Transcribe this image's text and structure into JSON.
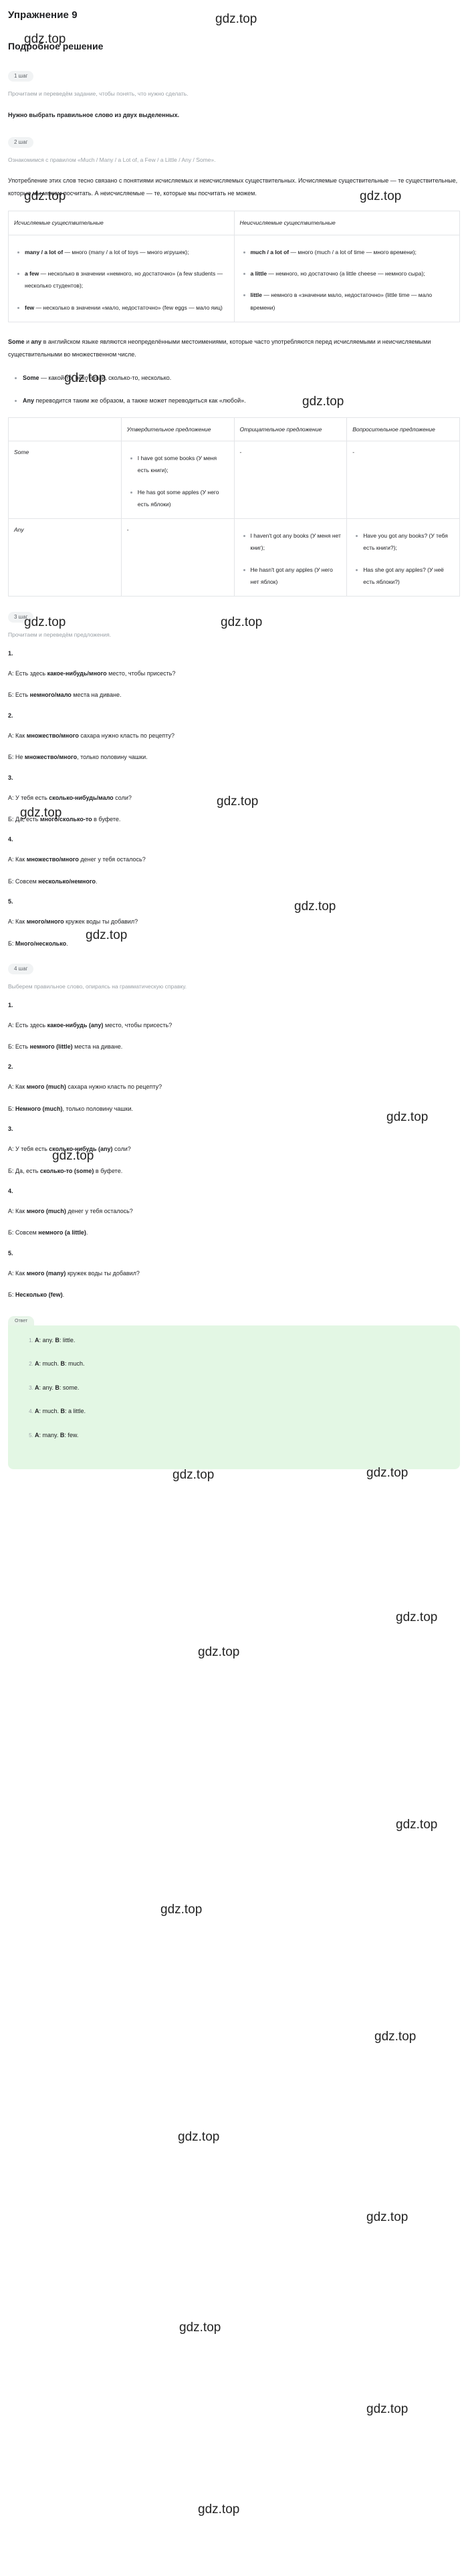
{
  "watermark": {
    "text": "gdz.top"
  },
  "header": {
    "title": "Упражнение 9",
    "subtitle": "Подробное решение"
  },
  "steps": [
    {
      "badge": "1 шаг",
      "hint": "Прочитаем и переведём задание, чтобы понять, что нужно сделать.",
      "statement": "Нужно выбрать правильное слово из двух выделенных."
    },
    {
      "badge": "2 шаг",
      "hint": "Ознакомимся с правилом «Much / Many / a Lot of, a Few / a Little / Any / Some».",
      "paragraph": "Употребление этих слов тесно связано с понятиями исчисляемых и неисчисляемых существительных. Исчисляемые существительные — те существительные, которые мы можем посчитать. А неисчисляемые — те, которые мы посчитать не можем."
    },
    {
      "badge": "3 шаг",
      "hint": "Прочитаем и переведём предложения."
    },
    {
      "badge": "4 шаг",
      "hint": "Выберем правильное слово, опираясь на грамматическую справку."
    }
  ],
  "nouns_table": {
    "headers": [
      "Исчисляемые существительные",
      "Неисчисляемые существительные"
    ],
    "countable": [
      {
        "term": "many / a lot of",
        "rest": " — много (many / a lot of toys — много игрушек);"
      },
      {
        "term": "a few",
        "rest": " — несколько в значении «немного, но достаточно» (a few students — несколько студентов);"
      },
      {
        "term": "few",
        "rest": " — несколько в значении «мало, недостаточно» (few eggs — мало яиц)"
      }
    ],
    "uncountable": [
      {
        "term": "much / a lot of",
        "rest": " — много (much / a lot of time — много времени);"
      },
      {
        "term": "a little",
        "rest": " — немного, но достаточно (a little cheese — немного сыра);"
      },
      {
        "term": "little",
        "rest": " — немного в «значении мало, недостаточно» (little time — мало времени)"
      }
    ]
  },
  "some_any_intro": {
    "lead_bold_1": "Some",
    "lead_mid": " и ",
    "lead_bold_2": "any",
    "lead_rest": " в английском языке являются неопределёнными местоимениями, которые часто употребляются перед исчисляемыми и неисчисляемыми существительными во множественном числе.",
    "bullets": [
      {
        "term": "Some",
        "rest": " — какой-то, некоторый, сколько-то, несколько."
      },
      {
        "term": "Any",
        "rest": " переводится таким же образом, а также может переводиться как «любой»."
      }
    ]
  },
  "some_any_table": {
    "headers": [
      "",
      "Утвердительное предложение",
      "Отрицательное предложение",
      "Вопросительное предложение"
    ],
    "rows": [
      {
        "label": "Some",
        "affirmative": [
          "I have got some books (У меня есть книги);",
          "He has got some apples (У него есть яблоки)"
        ],
        "negative_dash": "-",
        "interrogative_dash": "-"
      },
      {
        "label": "Any",
        "affirmative_dash": "-",
        "negative": [
          "I haven't got any books (У меня нет книг);",
          "He hasn't got any apples (У него нет яблок)"
        ],
        "interrogative": [
          "Have you got any books? (У тебя есть книги?);",
          "Has she got any apples? (У неё есть яблоки?)"
        ]
      }
    ]
  },
  "step3_items": [
    {
      "num": "1.",
      "a_prefix": "А: Есть здесь ",
      "a_bold": "какое-нибудь/много",
      "a_suffix": " место, чтобы присесть?",
      "b_prefix": "Б: Есть ",
      "b_bold": "немного/мало",
      "b_suffix": " места на диване."
    },
    {
      "num": "2.",
      "a_prefix": "А: Как ",
      "a_bold": "множество/много",
      "a_suffix": " сахара нужно класть по рецепту?",
      "b_prefix": "Б: Не ",
      "b_bold": "множество/много",
      "b_suffix": ", только половину чашки."
    },
    {
      "num": "3.",
      "a_prefix": "А: У тебя есть ",
      "a_bold": "сколько-нибудь/мало",
      "a_suffix": " соли?",
      "b_prefix": "Б: Да, есть ",
      "b_bold": "много/сколько-то",
      "b_suffix": " в буфете."
    },
    {
      "num": "4.",
      "a_prefix": "А: Как ",
      "a_bold": "множество/много",
      "a_suffix": " денег у тебя осталось?",
      "b_prefix": "Б: Совсем ",
      "b_bold": "несколько/немного",
      "b_suffix": "."
    },
    {
      "num": "5.",
      "a_prefix": "А: Как ",
      "a_bold": "много/много",
      "a_suffix": " кружек воды ты добавил?",
      "b_prefix": "Б: ",
      "b_bold": "Много/несколько",
      "b_suffix": "."
    }
  ],
  "step4_items": [
    {
      "num": "1.",
      "a_prefix": "А: Есть здесь ",
      "a_bold": "какое-нибудь (any)",
      "a_suffix": " место, чтобы присесть?",
      "b_prefix": "Б: Есть ",
      "b_bold": "немного (little)",
      "b_suffix": " места на диване."
    },
    {
      "num": "2.",
      "a_prefix": "А: Как ",
      "a_bold": "много (much)",
      "a_suffix": " сахара нужно класть по рецепту?",
      "b_prefix": "Б: ",
      "b_bold": "Немного (much)",
      "b_suffix": ", только половину чашки."
    },
    {
      "num": "3.",
      "a_prefix": "А: У тебя есть ",
      "a_bold": "сколько-нибудь (any)",
      "a_suffix": " соли?",
      "b_prefix": "Б: Да, есть ",
      "b_bold": "сколько-то (some)",
      "b_suffix": " в буфете."
    },
    {
      "num": "4.",
      "a_prefix": "А: Как ",
      "a_bold": "много (much)",
      "a_suffix": " денег у тебя осталось?",
      "b_prefix": "Б: Совсем ",
      "b_bold": "немного (a little)",
      "b_suffix": "."
    },
    {
      "num": "5.",
      "a_prefix": "А: Как ",
      "a_bold": "много (many)",
      "a_suffix": " кружек воды ты добавил?",
      "b_prefix": "Б: ",
      "b_bold": "Несколько (few)",
      "b_suffix": "."
    }
  ],
  "answer": {
    "badge": "Ответ",
    "items": [
      {
        "a_label": "A",
        "a_value": ": any. ",
        "b_label": "B",
        "b_value": ": little."
      },
      {
        "a_label": "A",
        "a_value": ": much. ",
        "b_label": "B",
        "b_value": ": much."
      },
      {
        "a_label": "A",
        "a_value": ": any. ",
        "b_label": "B",
        "b_value": ": some."
      },
      {
        "a_label": "A",
        "a_value": ": much. ",
        "b_label": "B",
        "b_value": ": a little."
      },
      {
        "a_label": "A",
        "a_value": ": many. ",
        "b_label": "B",
        "b_value": ": few."
      }
    ]
  }
}
